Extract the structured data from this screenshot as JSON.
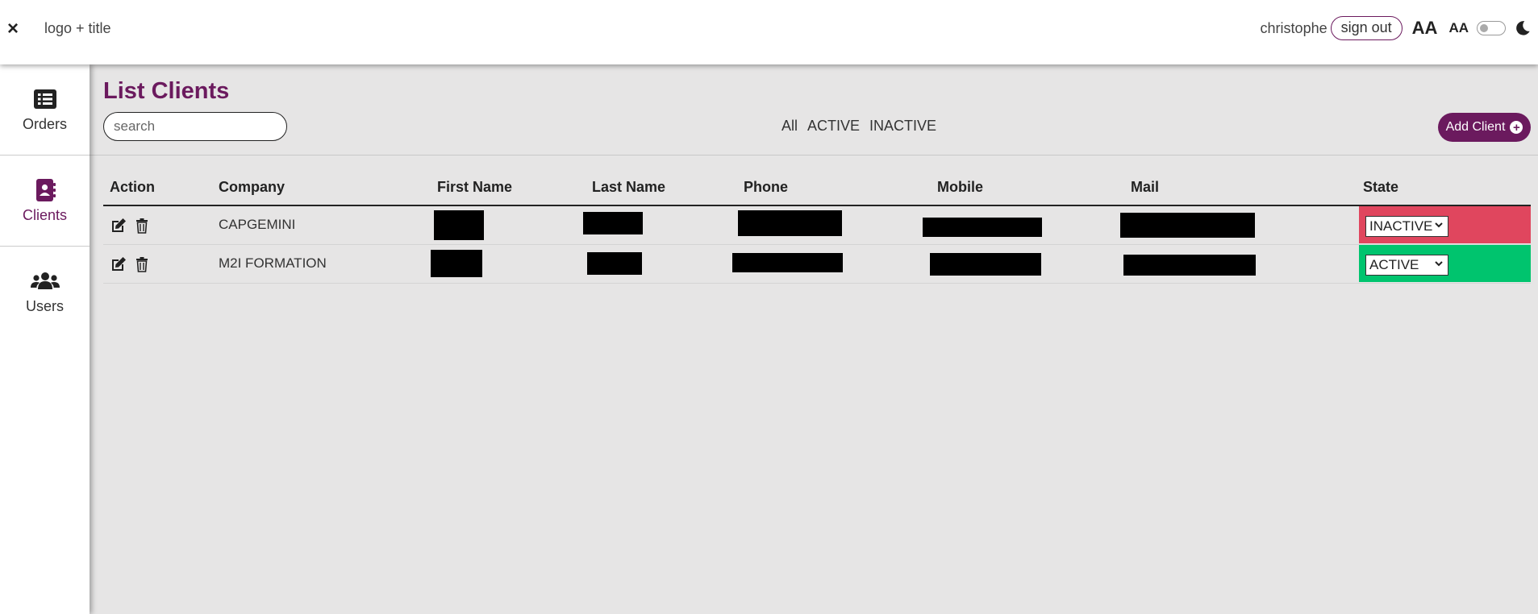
{
  "header": {
    "close_label": "×",
    "logo_title": "logo + title",
    "username": "christophe",
    "signout_label": "sign out",
    "font_large_label": "AA",
    "font_small_label": "AA",
    "theme_toggle_on": false,
    "theme_icon": "moon-icon"
  },
  "sidebar": {
    "items": [
      {
        "label": "Orders",
        "icon": "list-icon",
        "active": false
      },
      {
        "label": "Clients",
        "icon": "contact-book-icon",
        "active": true
      },
      {
        "label": "Users",
        "icon": "users-icon",
        "active": false
      }
    ]
  },
  "main": {
    "title": "List Clients",
    "search_placeholder": "search",
    "filters": [
      "All",
      "ACTIVE",
      "INACTIVE"
    ],
    "add_button_label": "Add Client",
    "add_button_icon": "plus-circle-icon"
  },
  "table": {
    "headers": [
      "Action",
      "Company",
      "First Name",
      "Last Name",
      "Phone",
      "Mobile",
      "Mail",
      "State"
    ],
    "rows": [
      {
        "company": "CAPGEMINI",
        "first_name": "[redacted]",
        "last_name": "[redacted]",
        "phone": "[redacted]",
        "mobile": "[redacted]",
        "mail": "[redacted]",
        "state": "INACTIVE"
      },
      {
        "company": "M2I FORMATION",
        "first_name": "[redacted]",
        "last_name": "[redacted]",
        "phone": "[redacted]",
        "mobile": "[redacted]",
        "mail": "[redacted]",
        "state": "ACTIVE"
      }
    ]
  },
  "colors": {
    "brand": "#6b1a5e",
    "inactive": "#e0465e",
    "active": "#00c46e",
    "background": "#e6e5e5"
  }
}
